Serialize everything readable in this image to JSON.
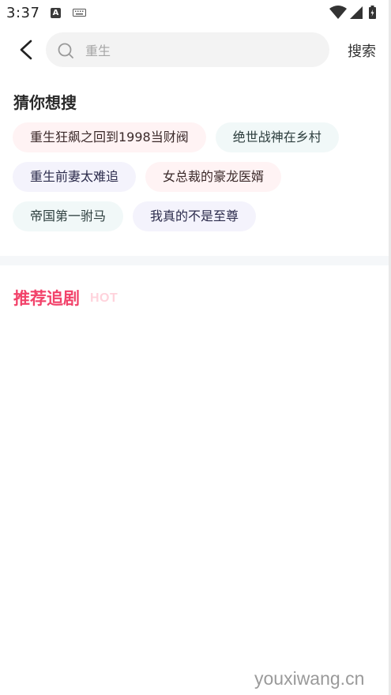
{
  "status_bar": {
    "time": "3:37",
    "left_icons": [
      "a-badge-icon",
      "keyboard-icon"
    ],
    "right_icons": [
      "wifi-icon",
      "signal-icon",
      "battery-icon"
    ],
    "a_badge": "A"
  },
  "search": {
    "placeholder": "重生",
    "button_label": "搜索"
  },
  "suggestions": {
    "title": "猜你想搜",
    "tags": [
      {
        "label": "重生狂飙之回到1998当财阀",
        "tone": "pink"
      },
      {
        "label": "绝世战神在乡村",
        "tone": "teal"
      },
      {
        "label": "重生前妻太难追",
        "tone": "lavender"
      },
      {
        "label": "女总裁的豪龙医婿",
        "tone": "pink"
      },
      {
        "label": "帝国第一驸马",
        "tone": "teal"
      },
      {
        "label": "我真的不是至尊",
        "tone": "lavender"
      }
    ]
  },
  "recommend": {
    "title": "推荐追剧",
    "hot_label": "HOT"
  },
  "watermark": "youxiwang.cn",
  "colors": {
    "accent": "#f2426a",
    "hot": "#ffd3dc",
    "tag_pink": "#fff3f4",
    "tag_teal": "#f1f8f8",
    "tag_lavender": "#f4f3fc",
    "search_bg": "#f3f3f3"
  }
}
